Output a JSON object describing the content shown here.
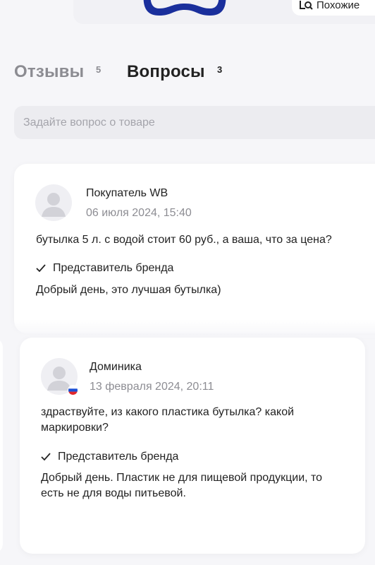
{
  "header": {
    "similar_label": "Похожие"
  },
  "tabs": [
    {
      "label": "Отзывы",
      "count": "5",
      "active": false
    },
    {
      "label": "Вопросы",
      "count": "3",
      "active": true
    }
  ],
  "ask": {
    "placeholder": "Задайте вопрос о товаре",
    "value": ""
  },
  "questions": [
    {
      "author": "Покупатель WB",
      "date": "06 июля 2024, 15:40",
      "text": "бутылка 5 л. с водой стоит 60 руб., а ваша, что за цена?",
      "answer_author": "Представитель бренда",
      "answer": "Добрый день, это лучшая бутылка)"
    },
    {
      "author": "Доминика",
      "date": "13 февраля 2024, 20:11",
      "text": "здраствуйте, из какого пластика бутылка? какой маркировки?",
      "answer_author": "Представитель бренда",
      "answer": "Добрый день. Пластик не для пищевой продукции, то есть не для воды питьевой."
    }
  ],
  "icons": {
    "similar": "image-search-icon",
    "check": "check-icon",
    "avatar": "user-avatar-icon",
    "flag": "russia-flag-icon"
  },
  "colors": {
    "background": "#f6f6f9",
    "product_handle": "#1a2f9c",
    "muted_text": "#8d8d93",
    "input_bg": "#ececf0"
  }
}
